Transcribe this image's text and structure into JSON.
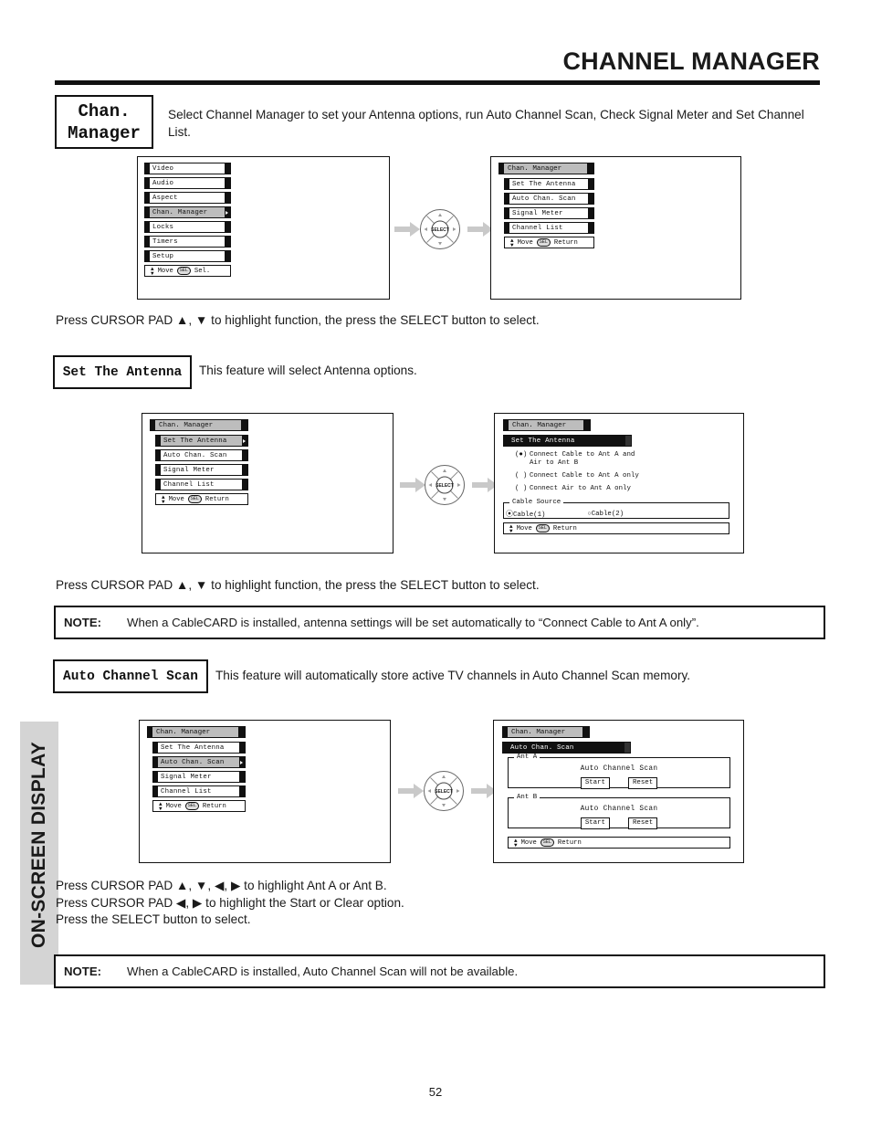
{
  "header": {
    "title": "CHANNEL MANAGER"
  },
  "side_tab": {
    "label": "ON-SCREEN DISPLAY"
  },
  "footer": {
    "page_number": "52"
  },
  "sections": {
    "chan_manager": {
      "box_line1": "Chan.",
      "box_line2": "Manager",
      "description": "Select Channel Manager to set your Antenna options, run Auto Channel Scan, Check Signal Meter and Set Channel List.",
      "instruction": "Press CURSOR PAD ▲, ▼ to highlight function, the press the SELECT button to select."
    },
    "set_antenna": {
      "box_label": "Set The Antenna",
      "description": "This feature will select Antenna options.",
      "instruction": "Press CURSOR PAD ▲, ▼ to highlight function, the press the SELECT button to select.",
      "note_label": "NOTE:",
      "note_text": "When a CableCARD is installed, antenna settings will be set automatically to “Connect Cable to Ant A only”."
    },
    "auto_scan": {
      "box_label": "Auto Channel Scan",
      "description": "This feature will automatically store active TV channels in Auto Channel Scan memory.",
      "instruction_line1": "Press CURSOR PAD ▲, ▼, ◀, ▶ to highlight Ant A or Ant B.",
      "instruction_line2": "Press CURSOR PAD ◀, ▶ to highlight the Start or Clear option.",
      "instruction_line3": "Press the SELECT button to select.",
      "note_label": "NOTE:",
      "note_text": "When a CableCARD is installed, Auto Channel Scan will not be available."
    }
  },
  "osd": {
    "main_menu": {
      "items": [
        "Video",
        "Audio",
        "Aspect",
        "Chan. Manager",
        "Locks",
        "Timers",
        "Setup"
      ],
      "selected_index": 3,
      "help_move": "Move",
      "help_key": "SEL",
      "help_action": "Sel."
    },
    "chan_manager_menu": {
      "title": "Chan. Manager",
      "items": [
        "Set The Antenna",
        "Auto Chan. Scan",
        "Signal Meter",
        "Channel List"
      ],
      "help_move": "Move",
      "help_key": "SEL",
      "help_action": "Return"
    },
    "antenna_screen": {
      "title": "Chan. Manager",
      "subtitle": "Set The Antenna",
      "options": [
        {
          "selected": true,
          "line1": "Connect Cable to Ant A and",
          "line2": "Air to Ant B"
        },
        {
          "selected": false,
          "line1": "Connect Cable to Ant A only",
          "line2": ""
        },
        {
          "selected": false,
          "line1": "Connect Air to Ant A only",
          "line2": ""
        }
      ],
      "cable_source_legend": "Cable Source",
      "cable_source_options": [
        {
          "label": "Cable(1)",
          "selected": true
        },
        {
          "label": "Cable(2)",
          "selected": false
        }
      ],
      "help_move": "Move",
      "help_key": "SEL",
      "help_action": "Return"
    },
    "auto_scan_screen": {
      "title": "Chan. Manager",
      "subtitle": "Auto Chan. Scan",
      "groups": [
        {
          "legend": "Ant A",
          "heading": "Auto Channel Scan",
          "buttons": [
            "Start",
            "Reset"
          ]
        },
        {
          "legend": "Ant B",
          "heading": "Auto Channel Scan",
          "buttons": [
            "Start",
            "Reset"
          ]
        }
      ],
      "help_move": "Move",
      "help_key": "SEL",
      "help_action": "Return"
    }
  },
  "icons": {
    "dpad_center_label": "SELECT"
  },
  "colors": {
    "accent_black": "#111111",
    "highlight_grey": "#bdbdbd",
    "tab_grey": "#d4d4d4"
  }
}
